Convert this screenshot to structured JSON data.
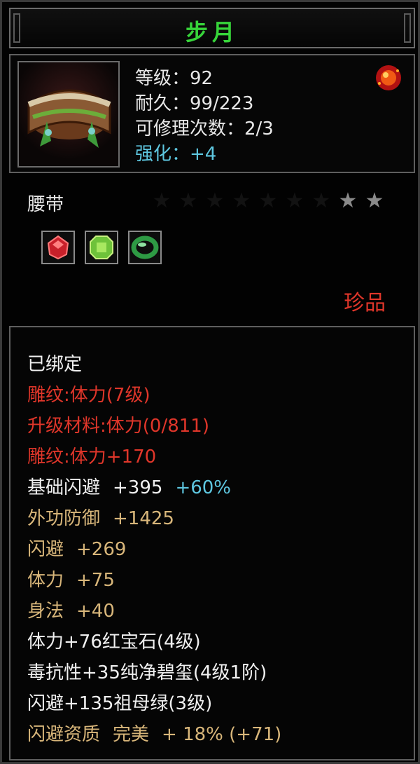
{
  "window": {
    "title": "步月"
  },
  "item": {
    "level_text": "等级：92",
    "durability_text": "耐久：99/223",
    "repairs_text": "可修理次数：2/3",
    "enhance_text": "强化：+4",
    "type": "腰带",
    "stars_total": 9,
    "stars_filled": 2,
    "rarity": "珍品",
    "icon": "belt-icon",
    "corner_icon": "red-gem-emblem-icon",
    "sockets": [
      {
        "name": "ruby-gem-icon",
        "color": "#c8202a"
      },
      {
        "name": "emerald-gem-icon",
        "color": "#6ec23a"
      },
      {
        "name": "jade-ring-icon",
        "color": "#2e9a44"
      }
    ]
  },
  "details": {
    "bound": "已绑定",
    "engrave": "雕纹:体力(7级)",
    "upgrade_material": "升级材料:体力(0/811)",
    "engrave_bonus": "雕纹:体力+170",
    "base_dodge_label": "基础闪避",
    "base_dodge_value": "+395",
    "base_dodge_pct": "+60%",
    "outer_def_label": "外功防御",
    "outer_def_value": "+1425",
    "dodge_label": "闪避",
    "dodge_value": "+269",
    "stamina_label": "体力",
    "stamina_value": "+75",
    "agility_label": "身法",
    "agility_value": "+40",
    "gem1": "体力+76红宝石(4级)",
    "gem2": "毒抗性+35纯净碧玺(4级1阶)",
    "gem3": "闪避+135祖母绿(3级)",
    "quality_label": "闪避资质",
    "quality_grade": "完美",
    "quality_value": "+ 18% (+71)"
  },
  "colors": {
    "title": "#37d43a",
    "red": "#e0362a",
    "gold": "#d8b67a",
    "cyan": "#5ec7e0"
  }
}
